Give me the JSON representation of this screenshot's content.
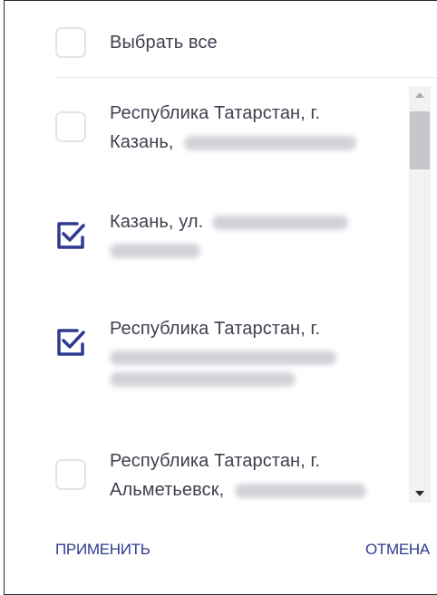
{
  "select_all": {
    "label": "Выбрать все",
    "checked": false
  },
  "items": [
    {
      "lines": [
        "Республика Татарстан, г.",
        "Казань,"
      ],
      "checked": false
    },
    {
      "lines": [
        "Казань, ул."
      ],
      "checked": true
    },
    {
      "lines": [
        "Республика Татарстан, г."
      ],
      "checked": true
    },
    {
      "lines": [
        "Республика Татарстан, г.",
        "Альметьевск,"
      ],
      "checked": false
    }
  ],
  "footer": {
    "apply_label": "ПРИМЕНИТЬ",
    "cancel_label": "ОТМЕНА"
  },
  "colors": {
    "accent": "#2f3b8f",
    "text": "#3e3f4f",
    "checkbox_border": "#e2e4ea",
    "scrollbar_thumb": "#c7c7cb"
  },
  "icons": {
    "checked": "checkmark-icon",
    "scroll_up": "triangle-up-icon",
    "scroll_down": "triangle-down-icon"
  }
}
